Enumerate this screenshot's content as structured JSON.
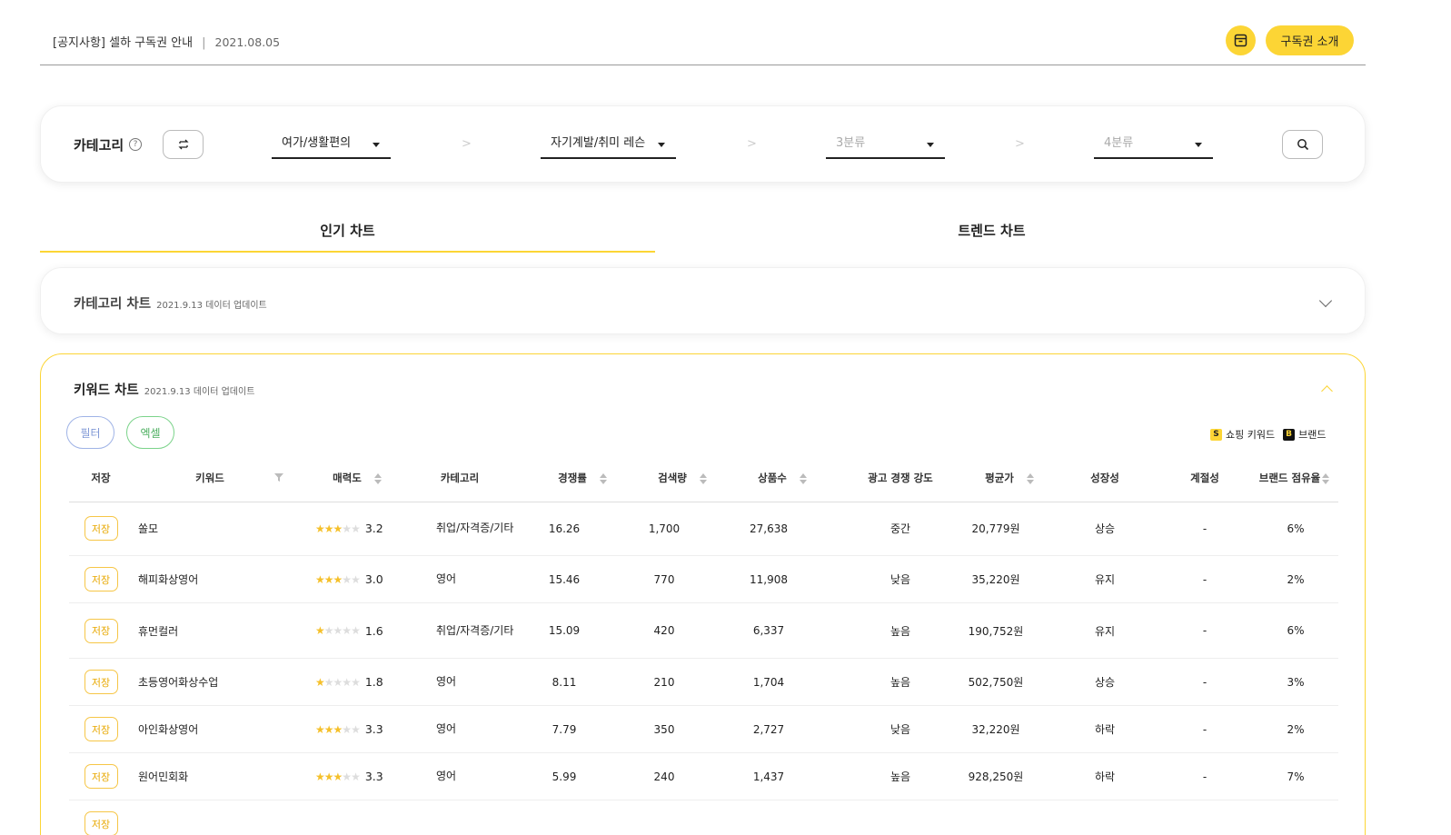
{
  "header": {
    "notice_title": "[공지사항] 셀하 구독권 안내",
    "notice_date": "2021.08.05",
    "cart_icon": "box-icon",
    "intro_button": "구독권 소개",
    "accent_color": "#fcd535"
  },
  "category_filter": {
    "label": "카테고리",
    "help": "?",
    "level1": "여가/생활편의",
    "level2": "자기계발/취미 레슨",
    "level3_placeholder": "3분류",
    "level4_placeholder": "4분류",
    "separator": ">"
  },
  "tabs": {
    "popular": "인기 차트",
    "trend": "트렌드 차트",
    "active": "인기 차트"
  },
  "category_chart": {
    "title": "카테고리 차트",
    "updated": "2021.9.13 데이터 업데이트",
    "expanded": false
  },
  "keyword_chart": {
    "title": "키워드 차트",
    "updated": "2021.9.13 데이터 업데이트",
    "expanded": true,
    "filter_button": "필터",
    "excel_button": "엑셀",
    "legend_shopping_badge": "S",
    "legend_shopping": "쇼핑 키워드",
    "legend_brand_badge": "B",
    "legend_brand": "브랜드",
    "columns": {
      "save": "저장",
      "keyword": "키워드",
      "attractiveness": "매력도",
      "category": "카테고리",
      "competition": "경쟁률",
      "search_volume": "검색량",
      "product_count": "상품수",
      "ad_intensity": "광고 경쟁 강도",
      "avg_price": "평균가",
      "growth": "성장성",
      "seasonality": "계절성",
      "brand_share": "브랜드 점유율"
    },
    "save_label": "저장",
    "rows": [
      {
        "keyword": "쏠모",
        "rating": 3.2,
        "rating_text": "3.2",
        "category": "취업/자격증/기타",
        "competition": "16.26",
        "search_volume": "1,700",
        "product_count": "27,638",
        "ad_intensity": "중간",
        "avg_price": "20,779원",
        "growth": "상승",
        "seasonality": "-",
        "brand_share": "6%"
      },
      {
        "keyword": "해피화상영어",
        "rating": 3.0,
        "rating_text": "3.0",
        "category": "영어",
        "competition": "15.46",
        "search_volume": "770",
        "product_count": "11,908",
        "ad_intensity": "낮음",
        "avg_price": "35,220원",
        "growth": "유지",
        "seasonality": "-",
        "brand_share": "2%"
      },
      {
        "keyword": "휴먼컬러",
        "rating": 1.6,
        "rating_text": "1.6",
        "category": "취업/자격증/기타",
        "competition": "15.09",
        "search_volume": "420",
        "product_count": "6,337",
        "ad_intensity": "높음",
        "avg_price": "190,752원",
        "growth": "유지",
        "seasonality": "-",
        "brand_share": "6%"
      },
      {
        "keyword": "초등영어화상수업",
        "rating": 1.8,
        "rating_text": "1.8",
        "category": "영어",
        "competition": "8.11",
        "search_volume": "210",
        "product_count": "1,704",
        "ad_intensity": "높음",
        "avg_price": "502,750원",
        "growth": "상승",
        "seasonality": "-",
        "brand_share": "3%"
      },
      {
        "keyword": "아인화상영어",
        "rating": 3.3,
        "rating_text": "3.3",
        "category": "영어",
        "competition": "7.79",
        "search_volume": "350",
        "product_count": "2,727",
        "ad_intensity": "낮음",
        "avg_price": "32,220원",
        "growth": "하락",
        "seasonality": "-",
        "brand_share": "2%"
      },
      {
        "keyword": "원어민회화",
        "rating": 3.3,
        "rating_text": "3.3",
        "category": "영어",
        "competition": "5.99",
        "search_volume": "240",
        "product_count": "1,437",
        "ad_intensity": "높음",
        "avg_price": "928,250원",
        "growth": "하락",
        "seasonality": "-",
        "brand_share": "7%"
      }
    ]
  }
}
